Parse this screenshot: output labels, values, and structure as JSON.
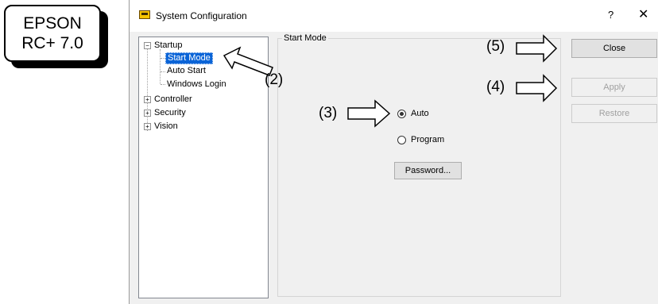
{
  "badge": {
    "line1": "EPSON",
    "line2": "RC+ 7.0"
  },
  "window": {
    "title": "System Configuration",
    "help_label": "?",
    "close_label": "✕"
  },
  "tree": {
    "startup": "Startup",
    "start_mode": "Start Mode",
    "auto_start": "Auto Start",
    "windows_login": "Windows Login",
    "controller": "Controller",
    "security": "Security",
    "vision": "Vision",
    "expand_sign": "+",
    "collapse_sign": "−"
  },
  "start_mode": {
    "group_title": "Start Mode",
    "auto_label": "Auto",
    "program_label": "Program",
    "selected": "Auto",
    "password_button": "Password..."
  },
  "buttons": {
    "close": "Close",
    "apply": "Apply",
    "restore": "Restore"
  },
  "annotations": {
    "a2": "(2)",
    "a3": "(3)",
    "a4": "(4)",
    "a5": "(5)"
  }
}
